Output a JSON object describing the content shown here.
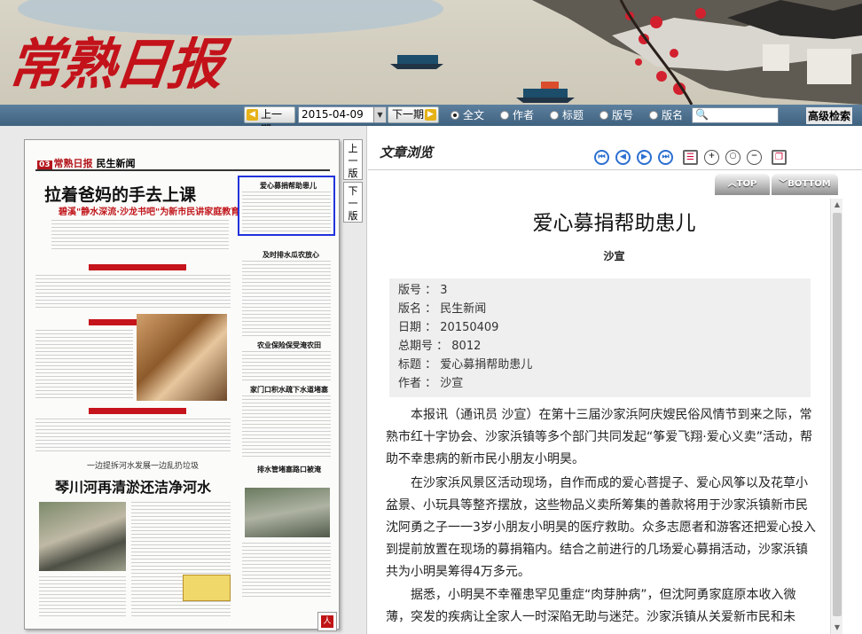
{
  "banner": {
    "logo_text": "常熟日报",
    "prev_label": "上一期",
    "next_label": "下一期",
    "date_value": "2015-04-09",
    "search_options": [
      {
        "label": "全文",
        "selected": true
      },
      {
        "label": "作者",
        "selected": false
      },
      {
        "label": "标题",
        "selected": false
      },
      {
        "label": "版号",
        "selected": false
      },
      {
        "label": "版名",
        "selected": false
      }
    ],
    "search_placeholder": "",
    "advanced_label": "高级检索"
  },
  "paper": {
    "masthead_num": "03",
    "masthead_paper": "常熟日报",
    "masthead_section": "民生新闻",
    "headline_main": "拉着爸妈的手去上课",
    "subhead_main": "碧溪\"静水深流·沙龙书吧\"为新市民讲家庭教育",
    "headline_second": "琴川河再清淤还洁净河水",
    "kicker_second": "一边提拆河水发展一边乱扔垃圾",
    "side_heads": [
      "爱心募捐帮助患儿",
      "及时排水瓜农放心",
      "农业保险保受淹农田",
      "家门口积水疏下水道堵塞",
      "排水管堵塞路口被淹"
    ],
    "ver_up": "上一版",
    "ver_down": "下一版",
    "pdf_label": "人"
  },
  "viewer": {
    "panel_title": "文章浏览",
    "top_label": "TOP",
    "bottom_label": "BOTTOM",
    "icons": [
      "first-icon",
      "prev-icon",
      "next-icon",
      "last-icon",
      "list-icon",
      "zoom-in-icon",
      "zoom-reset-icon",
      "zoom-out-icon",
      "copy-icon"
    ]
  },
  "article": {
    "title": "爱心募捐帮助患儿",
    "author": "沙宣",
    "meta": [
      {
        "label": "版号",
        "value": "3"
      },
      {
        "label": "版名",
        "value": "民生新闻"
      },
      {
        "label": "日期",
        "value": "20150409"
      },
      {
        "label": "总期号",
        "value": "8012"
      },
      {
        "label": "标题",
        "value": "爱心募捐帮助患儿"
      },
      {
        "label": "作者",
        "value": "沙宣"
      }
    ],
    "paragraphs": [
      "本报讯（通讯员 沙宣）在第十三届沙家浜阿庆嫂民俗风情节到来之际，常熟市红十字协会、沙家浜镇等多个部门共同发起“筝爱飞翔·爱心义卖”活动，帮助不幸患病的新市民小朋友小明昊。",
      "在沙家浜风景区活动现场，自作而成的爱心菩提子、爱心风筝以及花草小盆景、小玩具等整齐摆放，这些物品义卖所筹集的善款将用于沙家浜镇新市民沈阿勇之子一一3岁小朋友小明昊的医疗救助。众多志愿者和游客还把爱心投入到提前放置在现场的募捐箱内。结合之前进行的几场爱心募捐活动，沙家浜镇共为小明昊筹得4万多元。",
      "据悉，小明昊不幸罹患罕见重症“肉芽肿病”，但沈阿勇家庭原本收入微薄，突发的疾病让全家人一时深陷无助与迷茫。沙家浜镇从关爱新市民和未"
    ]
  }
}
